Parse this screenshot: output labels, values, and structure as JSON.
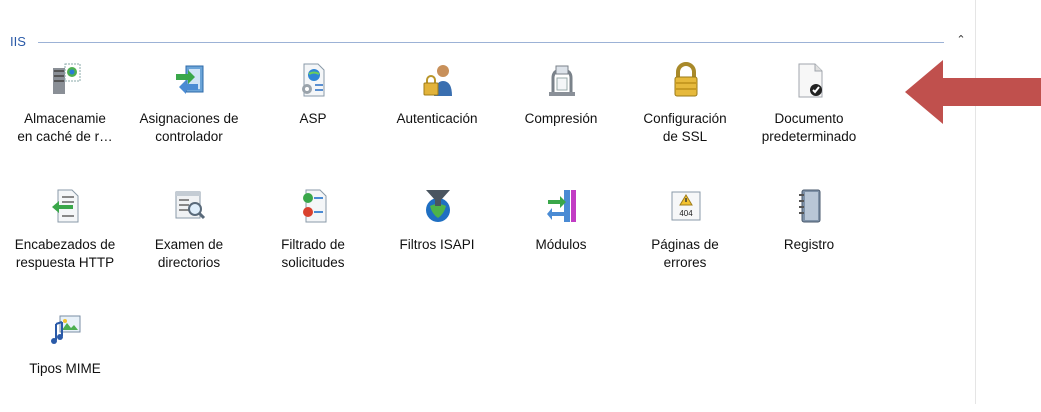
{
  "group": {
    "title": "IIS",
    "collapse_glyph": "⌃"
  },
  "features": [
    {
      "label": "Almacenamie\nen caché de r…",
      "icon": "output-cache-icon"
    },
    {
      "label": "Asignaciones de\ncontrolador",
      "icon": "handler-mappings-icon"
    },
    {
      "label": "ASP",
      "icon": "asp-icon"
    },
    {
      "label": "Autenticación",
      "icon": "authentication-icon"
    },
    {
      "label": "Compresión",
      "icon": "compression-icon"
    },
    {
      "label": "Configuración\nde SSL",
      "icon": "ssl-lock-icon"
    },
    {
      "label": "Documento\npredeterminado",
      "icon": "default-document-icon"
    },
    {
      "label": "Encabezados de\nrespuesta HTTP",
      "icon": "http-headers-icon"
    },
    {
      "label": "Examen de\ndirectorios",
      "icon": "directory-browsing-icon"
    },
    {
      "label": "Filtrado de\nsolicitudes",
      "icon": "request-filtering-icon"
    },
    {
      "label": "Filtros ISAPI",
      "icon": "isapi-filters-icon"
    },
    {
      "label": "Módulos",
      "icon": "modules-icon"
    },
    {
      "label": "Páginas de\nerrores",
      "icon": "error-pages-icon"
    },
    {
      "label": "Registro",
      "icon": "logging-icon"
    },
    {
      "label": "Tipos MIME",
      "icon": "mime-types-icon"
    }
  ],
  "error_icon_text": "404",
  "colors": {
    "accent": "#2a5aa8",
    "arrow": "#c0504d"
  }
}
